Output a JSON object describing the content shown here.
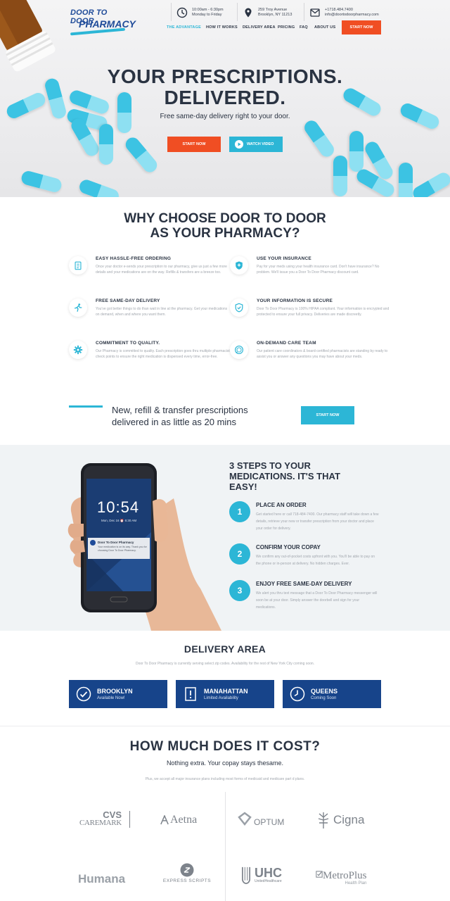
{
  "brand": {
    "logo_line1": "DOOR TO DOOR",
    "logo_line2": "PHARMACY"
  },
  "header": {
    "hours": [
      "10:00am - 6:30pm",
      "Monday to Friday"
    ],
    "address": [
      "259 Troy Avenue",
      "Brooklyn, NY 11213"
    ],
    "contact": [
      "+1718.484.7400",
      "info@doortodoorpharmacy.com"
    ]
  },
  "nav": {
    "items": [
      "THE ADVANTAGE",
      "HOW IT WORKS",
      "DELIVERY AREA",
      "PRICING",
      "FAQ",
      "ABOUT US"
    ],
    "active_index": 0,
    "cta": "START NOW"
  },
  "hero": {
    "title_line1": "YOUR PRESCRIPTIONS.",
    "title_line2": "DELIVERED.",
    "subtitle": "Free same-day delivery right to your door.",
    "start_button": "START NOW",
    "video_button": "WATCH VIDEO"
  },
  "why": {
    "title_prefix": "WHY CHOOSE ",
    "title_bold": "DOOR TO DOOR",
    "title_line2": "AS YOUR PHARMACY?",
    "features": [
      {
        "icon": "clipboard-icon",
        "title": "EASY HASSLE-FREE ORDERING",
        "desc": "Once your doctor e-sends your prescription to our pharmacy, give us just a few more details and your medications are on the way. Refills & transfers are a breeze too."
      },
      {
        "icon": "shield-plus-icon",
        "title": "USE YOUR INSURANCE",
        "desc": "Pay for your meds using your health insurance card. Don't have insurance? No problem. We'll issue you a Door To Door Pharmacy discount card."
      },
      {
        "icon": "runner-icon",
        "title": "FREE SAME-DAY DELIVERY",
        "desc": "You've got better things to do than wait in line at the pharmacy. Get your medications on demand, when and where you want them."
      },
      {
        "icon": "shield-check-icon",
        "title": "YOUR INFORMATION IS SECURE",
        "desc": "Door To Door Pharmacy is 100% HIPAA compliant. Your information is encrypted and protected to ensure your full privacy. Deliveries are made discreetly."
      },
      {
        "icon": "gear-icon",
        "title": "COMMITMENT TO QUALITY.",
        "desc": "Our Pharmacy is committed to quality. Each prescription goes thru multiple pharmacist check points to ensure the right medication is dispensed every time, error-free."
      },
      {
        "icon": "chat-icon",
        "title": "ON-DEMAND CARE TEAM",
        "desc": "Our patient care coordinators & board-certified pharmacists are standing by ready to assist you or answer any questions you may have about your meds."
      }
    ]
  },
  "cta_band": {
    "text_line1": "New, refill & transfer prescriptions",
    "text_line2": "delivered in as little as 20 mins",
    "button": "START NOW"
  },
  "steps": {
    "title": "3 STEPS TO YOUR MEDICATIONS. IT'S THAT EASY!",
    "phone_time": "10:54",
    "phone_date": "Mon, Dec 16  ⏰ 6:30 AM",
    "notification_title": "Door To Door Pharmacy",
    "notification_body": "Your medication is on its way. Thank you for choosing Door To Door Pharmacy.",
    "items": [
      {
        "num": "1",
        "title": "PLACE AN ORDER",
        "desc": "Get started here or call 718-484-7400. Our pharmacy staff will take down a few details, retrieve your new or transfer prescription from your doctor and place your order for delivery."
      },
      {
        "num": "2",
        "title": "CONFIRM YOUR COPAY",
        "desc": "We confirm any out-of-pocket costs upfront with you. You'll be able to pay on the phone or in-person at delivery. No hidden charges. Ever."
      },
      {
        "num": "3",
        "title": "ENJOY FREE SAME-DAY DELIVERY",
        "desc": "We alert you thru text message that a Door To Door Pharmacy messenger will soon be at your door. Simply answer the doorbell and sign for your medications."
      }
    ]
  },
  "delivery": {
    "title": "DELIVERY AREA",
    "subtitle": "Door To Door Pharmacy is currently serving select zip codes. Availability for the rest of New York City coming soon.",
    "areas": [
      {
        "icon": "check-circle-icon",
        "name": "BROOKLYN",
        "status": "Available Now!"
      },
      {
        "icon": "exclamation-icon",
        "name": "MANAHATTAN",
        "status": "Limited Availability"
      },
      {
        "icon": "clock-icon",
        "name": "QUEENS",
        "status": "Coming Soon"
      }
    ]
  },
  "cost": {
    "title": "HOW MUCH DOES IT COST?",
    "subtitle": "Nothing extra. Your copay stays thesame.",
    "note": "Plus, we accept all major insurance plans including most forms of medicaid and medicare part d plans.",
    "insurers": {
      "cvs_top": "CVS",
      "cvs_bottom": "CAREMARK",
      "aetna": "Aetna",
      "optum": "OPTUM",
      "cigna": "Cigna",
      "humana": "Humana",
      "express": "EXPRESS SCRIPTS",
      "uhc": "UHC",
      "uhc_sub": "UnitedHealthcare",
      "metro": "MetroPlus",
      "metro_sub": "Health Plan"
    }
  }
}
